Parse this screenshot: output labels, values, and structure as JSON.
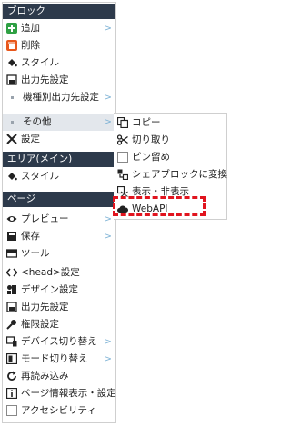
{
  "sections": {
    "block": "ブロック",
    "area": "エリア(メイン)",
    "page": "ページ"
  },
  "block_items": {
    "add": "追加",
    "delete": "削除",
    "style": "スタイル",
    "output": "出力先設定",
    "device_output": "機種別出力先設定",
    "other": "その他",
    "settings": "設定"
  },
  "area_items": {
    "style": "スタイル"
  },
  "page_items": {
    "preview": "プレビュー",
    "save": "保存",
    "tools": "ツール",
    "head": "<head>設定",
    "design": "デザイン設定",
    "output": "出力先設定",
    "permission": "権限設定",
    "device_switch": "デバイス切り替え",
    "mode_switch": "モード切り替え",
    "reload": "再読み込み",
    "page_info": "ページ情報表示・設定",
    "accessibility": "アクセシビリティ"
  },
  "submenu": {
    "copy": "コピー",
    "cut": "切り取り",
    "pin": "ピン留め",
    "share": "シェアブロックに変換",
    "toggle": "表示・非表示",
    "webapi": "WebAPI"
  },
  "arrow": ">",
  "colors": {
    "section_bg": "#2d3a4b",
    "highlight": "#e3e7ec",
    "dashed_box": "#e1141e",
    "add_icon": "#2ea043",
    "delete_icon": "#e8581c"
  }
}
